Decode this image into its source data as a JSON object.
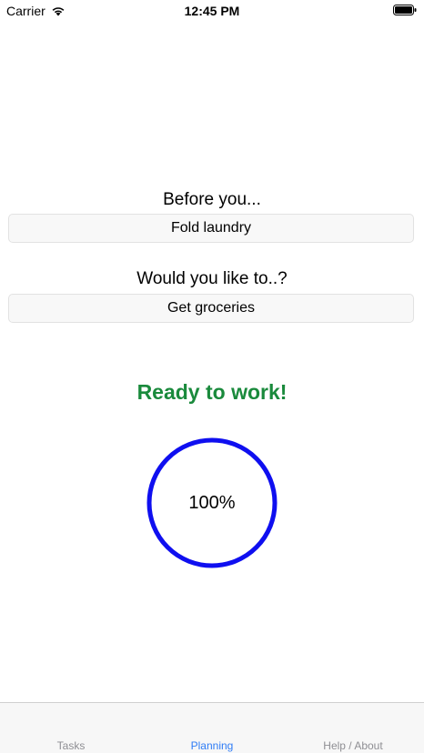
{
  "status_bar": {
    "carrier": "Carrier",
    "time": "12:45 PM",
    "icons": [
      "wifi-icon",
      "battery-icon"
    ]
  },
  "before": {
    "label": "Before you...",
    "task": "Fold laundry"
  },
  "would": {
    "label": "Would you like to..?",
    "task": "Get groceries"
  },
  "status": {
    "message": "Ready to work!",
    "message_color": "#1a8a3c"
  },
  "progress": {
    "text": "100%",
    "fraction": 1.0,
    "ring_color": "#0f0ff0"
  },
  "tabs": [
    {
      "label": "Tasks",
      "active": false
    },
    {
      "label": "Planning",
      "active": true
    },
    {
      "label": "Help / About",
      "active": false
    }
  ],
  "colors": {
    "accent": "#2f7cf6",
    "inactive_tab": "#8e8e93"
  }
}
